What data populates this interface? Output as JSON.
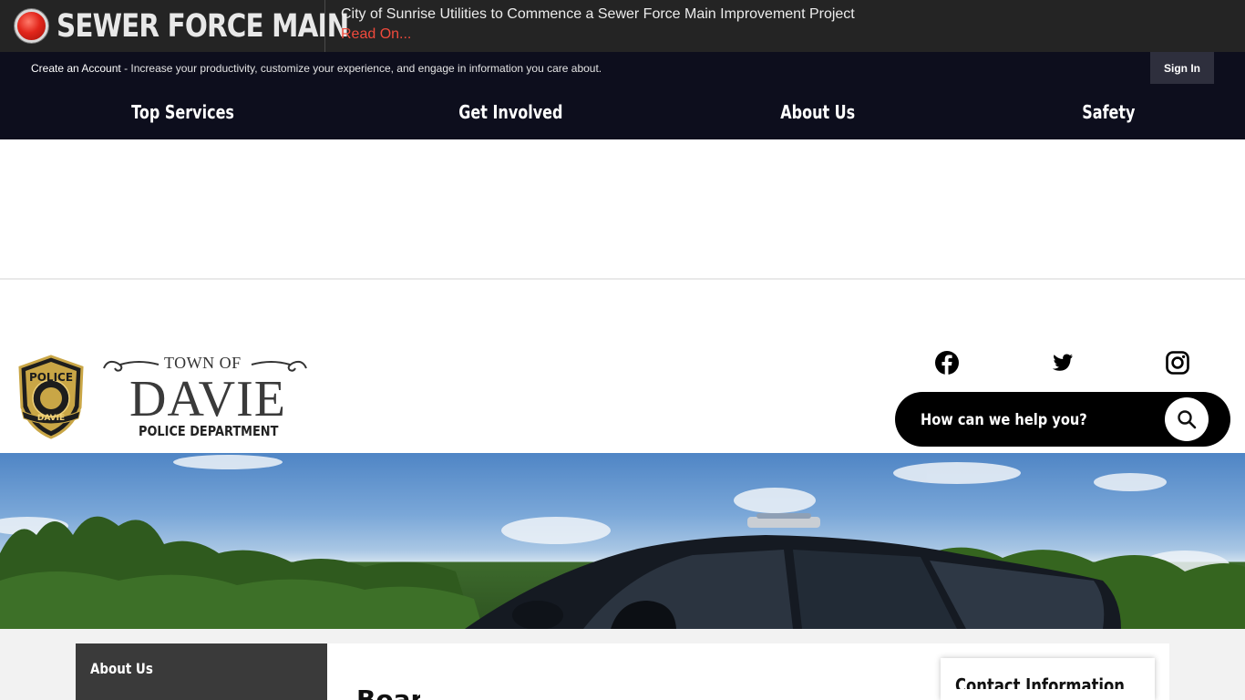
{
  "alert": {
    "title": "SEWER FORCE MAIN",
    "message": "City of Sunrise Utilities to Commence a Sewer Force Main Improvement Project",
    "link": "Read On..."
  },
  "account_bar": {
    "create_link": "Create an Account",
    "description": " - Increase your productivity, customize your experience, and engage in information you care about.",
    "sign_in": "Sign In"
  },
  "nav": {
    "items": [
      {
        "label": "Top Services"
      },
      {
        "label": "Get Involved"
      },
      {
        "label": "About Us"
      },
      {
        "label": "Safety"
      }
    ]
  },
  "logo": {
    "badge_text": "POLICE",
    "badge_sub": "DAVIE",
    "town_of": "TOWN OF",
    "name": "DAVIE",
    "department": "POLICE DEPARTMENT"
  },
  "social": [
    "facebook-icon",
    "twitter-icon",
    "instagram-icon"
  ],
  "search": {
    "placeholder": "How can we help you?"
  },
  "side_nav": {
    "title": "About Us"
  },
  "main": {
    "heading": "Board"
  },
  "contact": {
    "title": "Contact Information"
  }
}
